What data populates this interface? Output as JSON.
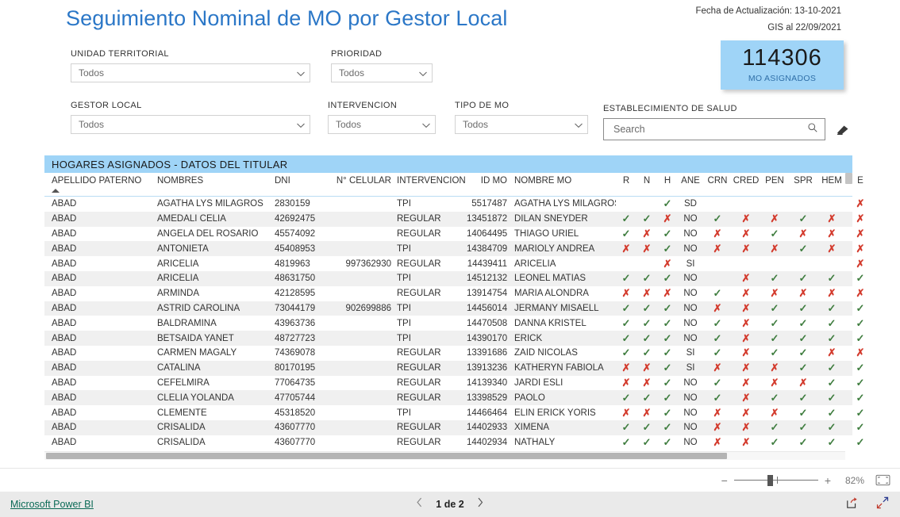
{
  "report": {
    "title": "Seguimiento Nominal de MO por Gestor Local",
    "meta_update": "Fecha de Actualización: 13-10-2021",
    "meta_gis": "GIS al 22/09/2021",
    "accent_blue": "#2b77c7",
    "card_blue": "#9fd4f7",
    "tick_color": "#3f7d3f",
    "cross_color": "#d33a2c"
  },
  "kpi": {
    "value": "114306",
    "label": "MO ASIGNADOS"
  },
  "filters": [
    {
      "label": "UNIDAD TERRITORIAL",
      "value": "Todos"
    },
    {
      "label": "PRIORIDAD",
      "value": "Todos"
    },
    {
      "label": "GESTOR LOCAL",
      "value": "Todos"
    },
    {
      "label": "INTERVENCION",
      "value": "Todos"
    },
    {
      "label": "TIPO DE MO",
      "value": "Todos"
    }
  ],
  "search": {
    "label": "ESTABLECIMIENTO DE SALUD",
    "placeholder": "Search",
    "value": ""
  },
  "table": {
    "title": "HOGARES ASIGNADOS - DATOS DEL TITULAR",
    "columns": [
      "APELLIDO PATERNO",
      "NOMBRES",
      "DNI",
      "N° CELULAR",
      "INTERVENCION",
      "ID MO",
      "NOMBRE MO",
      "R",
      "N",
      "H",
      "ANE",
      "CRN",
      "CRED",
      "PEN",
      "SPR",
      "HEM",
      "E"
    ],
    "sorted_column": "APELLIDO PATERNO",
    "sort_direction": "asc",
    "rows": [
      {
        "ap": "ABAD",
        "nom": "AGATHA LYS MILAGROS",
        "dni": "2830159",
        "cel": "",
        "int": "TPI",
        "idmo": "5517487",
        "nmo": "AGATHA LYS MILAGROS",
        "r": "",
        "n": "",
        "h": "v",
        "ane": "SD",
        "crn": "",
        "cred": "",
        "pen": "",
        "spr": "",
        "hem": "",
        "e": "x"
      },
      {
        "ap": "ABAD",
        "nom": "AMEDALI CELIA",
        "dni": "42692475",
        "cel": "",
        "int": "REGULAR",
        "idmo": "13451872",
        "nmo": "DILAN SNEYDER",
        "r": "v",
        "n": "v",
        "h": "x",
        "ane": "NO",
        "crn": "v",
        "cred": "x",
        "pen": "x",
        "spr": "v",
        "hem": "x",
        "e": "x"
      },
      {
        "ap": "ABAD",
        "nom": "ANGELA DEL ROSARIO",
        "dni": "45574092",
        "cel": "",
        "int": "REGULAR",
        "idmo": "14064495",
        "nmo": "THIAGO URIEL",
        "r": "v",
        "n": "x",
        "h": "v",
        "ane": "NO",
        "crn": "x",
        "cred": "x",
        "pen": "v",
        "spr": "x",
        "hem": "x",
        "e": "x"
      },
      {
        "ap": "ABAD",
        "nom": "ANTONIETA",
        "dni": "45408953",
        "cel": "",
        "int": "TPI",
        "idmo": "14384709",
        "nmo": "MARIOLY ANDREA",
        "r": "x",
        "n": "x",
        "h": "v",
        "ane": "NO",
        "crn": "x",
        "cred": "x",
        "pen": "x",
        "spr": "v",
        "hem": "x",
        "e": "x"
      },
      {
        "ap": "ABAD",
        "nom": "ARICELIA",
        "dni": "4819963",
        "cel": "997362930",
        "int": "REGULAR",
        "idmo": "14439411",
        "nmo": "ARICELIA",
        "r": "",
        "n": "",
        "h": "x",
        "ane": "SI",
        "crn": "",
        "cred": "",
        "pen": "",
        "spr": "",
        "hem": "",
        "e": "x"
      },
      {
        "ap": "ABAD",
        "nom": "ARICELIA",
        "dni": "48631750",
        "cel": "",
        "int": "TPI",
        "idmo": "14512132",
        "nmo": "LEONEL MATIAS",
        "r": "v",
        "n": "v",
        "h": "v",
        "ane": "NO",
        "crn": "",
        "cred": "x",
        "pen": "v",
        "spr": "v",
        "hem": "v",
        "e": "v"
      },
      {
        "ap": "ABAD",
        "nom": "ARMINDA",
        "dni": "42128595",
        "cel": "",
        "int": "REGULAR",
        "idmo": "13914754",
        "nmo": "MARIA ALONDRA",
        "r": "x",
        "n": "x",
        "h": "x",
        "ane": "NO",
        "crn": "v",
        "cred": "x",
        "pen": "x",
        "spr": "x",
        "hem": "x",
        "e": "x"
      },
      {
        "ap": "ABAD",
        "nom": "ASTRID CAROLINA",
        "dni": "73044179",
        "cel": "902699886",
        "int": "TPI",
        "idmo": "14456014",
        "nmo": "JERMANY MISAELL",
        "r": "v",
        "n": "v",
        "h": "v",
        "ane": "NO",
        "crn": "x",
        "cred": "x",
        "pen": "v",
        "spr": "v",
        "hem": "v",
        "e": "v"
      },
      {
        "ap": "ABAD",
        "nom": "BALDRAMINA",
        "dni": "43963736",
        "cel": "",
        "int": "TPI",
        "idmo": "14470508",
        "nmo": "DANNA KRISTEL",
        "r": "v",
        "n": "v",
        "h": "v",
        "ane": "NO",
        "crn": "v",
        "cred": "x",
        "pen": "v",
        "spr": "v",
        "hem": "v",
        "e": "v"
      },
      {
        "ap": "ABAD",
        "nom": "BETSAIDA YANET",
        "dni": "48727723",
        "cel": "",
        "int": "TPI",
        "idmo": "14390170",
        "nmo": "ERICK",
        "r": "v",
        "n": "v",
        "h": "v",
        "ane": "NO",
        "crn": "v",
        "cred": "x",
        "pen": "v",
        "spr": "v",
        "hem": "v",
        "e": "v"
      },
      {
        "ap": "ABAD",
        "nom": "CARMEN MAGALY",
        "dni": "74369078",
        "cel": "",
        "int": "REGULAR",
        "idmo": "13391686",
        "nmo": "ZAID NICOLAS",
        "r": "v",
        "n": "v",
        "h": "v",
        "ane": "SI",
        "crn": "v",
        "cred": "x",
        "pen": "v",
        "spr": "v",
        "hem": "x",
        "e": "x"
      },
      {
        "ap": "ABAD",
        "nom": "CATALINA",
        "dni": "80170195",
        "cel": "",
        "int": "REGULAR",
        "idmo": "13913236",
        "nmo": "KATHERYN FABIOLA",
        "r": "x",
        "n": "x",
        "h": "v",
        "ane": "SI",
        "crn": "x",
        "cred": "x",
        "pen": "x",
        "spr": "v",
        "hem": "v",
        "e": "v"
      },
      {
        "ap": "ABAD",
        "nom": "CEFELMIRA",
        "dni": "77064735",
        "cel": "",
        "int": "REGULAR",
        "idmo": "14139340",
        "nmo": "JARDI ESLI",
        "r": "x",
        "n": "x",
        "h": "v",
        "ane": "NO",
        "crn": "v",
        "cred": "x",
        "pen": "x",
        "spr": "x",
        "hem": "v",
        "e": "v"
      },
      {
        "ap": "ABAD",
        "nom": "CLELIA YOLANDA",
        "dni": "47705744",
        "cel": "",
        "int": "REGULAR",
        "idmo": "13398529",
        "nmo": "PAOLO",
        "r": "v",
        "n": "v",
        "h": "v",
        "ane": "NO",
        "crn": "v",
        "cred": "x",
        "pen": "v",
        "spr": "v",
        "hem": "v",
        "e": "v"
      },
      {
        "ap": "ABAD",
        "nom": "CLEMENTE",
        "dni": "45318520",
        "cel": "",
        "int": "TPI",
        "idmo": "14466464",
        "nmo": "ELIN ERICK YORIS",
        "r": "x",
        "n": "x",
        "h": "v",
        "ane": "NO",
        "crn": "x",
        "cred": "x",
        "pen": "x",
        "spr": "v",
        "hem": "v",
        "e": "v"
      },
      {
        "ap": "ABAD",
        "nom": "CRISALIDA",
        "dni": "43607770",
        "cel": "",
        "int": "REGULAR",
        "idmo": "14402933",
        "nmo": "XIMENA",
        "r": "v",
        "n": "v",
        "h": "v",
        "ane": "NO",
        "crn": "x",
        "cred": "x",
        "pen": "v",
        "spr": "v",
        "hem": "v",
        "e": "v"
      },
      {
        "ap": "ABAD",
        "nom": "CRISALIDA",
        "dni": "43607770",
        "cel": "",
        "int": "REGULAR",
        "idmo": "14402934",
        "nmo": "NATHALY",
        "r": "v",
        "n": "v",
        "h": "v",
        "ane": "NO",
        "crn": "x",
        "cred": "x",
        "pen": "v",
        "spr": "v",
        "hem": "v",
        "e": "v"
      }
    ]
  },
  "statusbar": {
    "zoom_minus": "−",
    "zoom_plus": "+",
    "zoom_percent": "82%"
  },
  "footer": {
    "brand": "Microsoft Power BI",
    "page_text": "1 de 2"
  }
}
